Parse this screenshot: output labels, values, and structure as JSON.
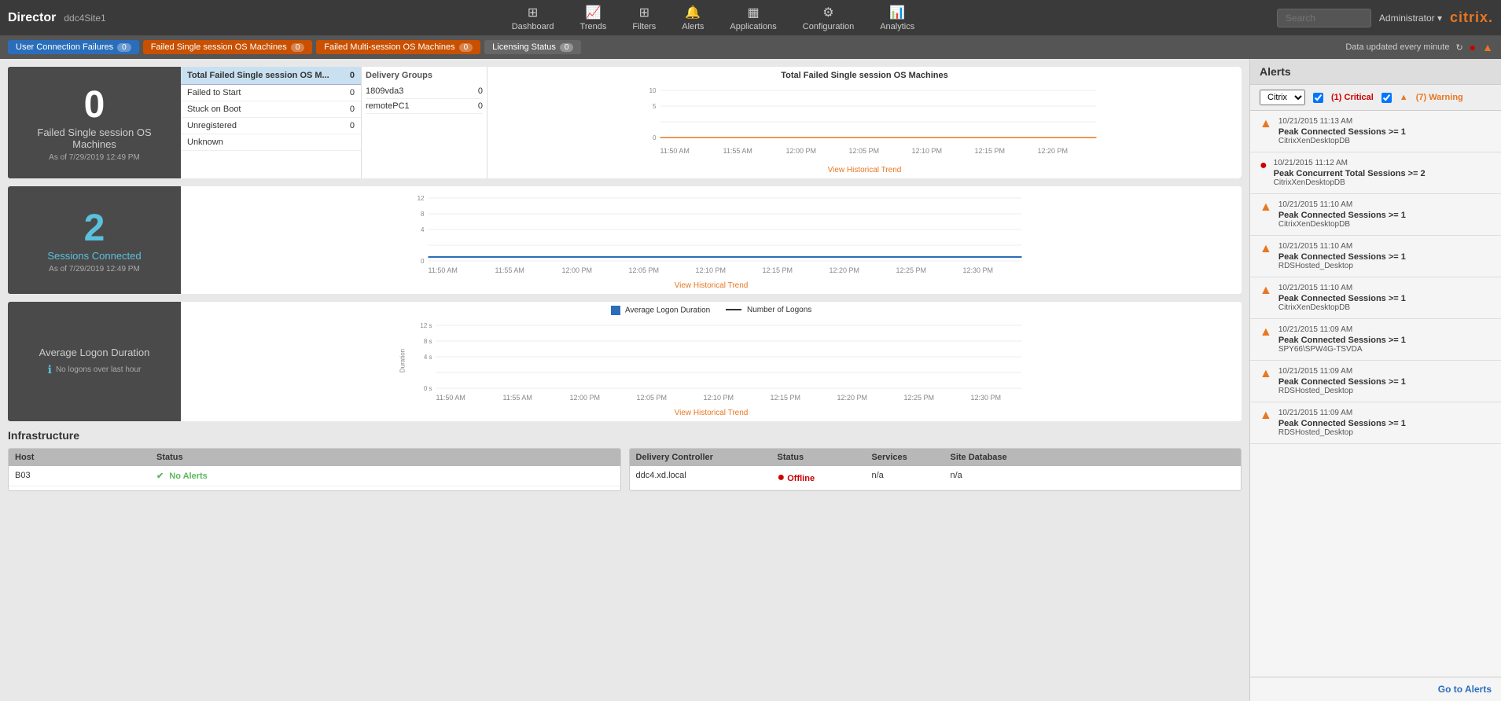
{
  "brand": {
    "title": "Director",
    "subtitle": "ddc4Site1"
  },
  "nav": {
    "items": [
      {
        "label": "Dashboard",
        "icon": "⊞"
      },
      {
        "label": "Trends",
        "icon": "📈"
      },
      {
        "label": "Filters",
        "icon": "🔽"
      },
      {
        "label": "Alerts",
        "icon": "🔔"
      },
      {
        "label": "Applications",
        "icon": "▦"
      },
      {
        "label": "Configuration",
        "icon": "⚙"
      },
      {
        "label": "Analytics",
        "icon": "📊"
      }
    ],
    "search_placeholder": "Search",
    "admin_label": "Administrator ▾",
    "citrix_label": "citrix."
  },
  "status_bar": {
    "badges": [
      {
        "label": "User Connection Failures",
        "count": "0",
        "type": "blue"
      },
      {
        "label": "Failed Single session OS Machines",
        "count": "0",
        "type": "orange"
      },
      {
        "label": "Failed Multi-session OS Machines",
        "count": "0",
        "type": "orange"
      },
      {
        "label": "Licensing Status",
        "count": "0",
        "type": "gray"
      }
    ],
    "update_text": "Data updated every minute",
    "refresh_icon": "↻"
  },
  "failed_machines": {
    "title": "Failed Single session OS Machines",
    "as_of": "As of 7/29/2019 12:49 PM",
    "count": "0",
    "table_header": "Total Failed Single session OS M...",
    "table_header_count": "0",
    "rows": [
      {
        "label": "Failed to Start",
        "count": "0"
      },
      {
        "label": "Stuck on Boot",
        "count": "0"
      },
      {
        "label": "Unregistered",
        "count": "0"
      },
      {
        "label": "Unknown",
        "count": ""
      }
    ],
    "delivery_groups_title": "Delivery Groups",
    "delivery_groups": [
      {
        "label": "1809vda3",
        "count": "0"
      },
      {
        "label": "remotePC1",
        "count": "0"
      }
    ],
    "chart_title": "Total Failed Single session OS Machines",
    "chart_times": [
      "11:50 AM",
      "11:55 AM",
      "12:00 PM",
      "12:05 PM",
      "12:10 PM",
      "12:15 PM",
      "12:20 PM"
    ],
    "view_trend": "View Historical Trend"
  },
  "sessions": {
    "count": "2",
    "label": "Sessions Connected",
    "as_of": "As of 7/29/2019 12:49 PM",
    "chart_times": [
      "11:50 AM",
      "11:55 AM",
      "12:00 PM",
      "12:05 PM",
      "12:10 PM",
      "12:15 PM",
      "12:20 PM",
      "12:25 PM",
      "12:30 PM"
    ],
    "view_trend": "View Historical Trend"
  },
  "logon": {
    "label": "Average Logon Duration",
    "no_logons": "No logons over last hour",
    "legend_avg": "Average Logon Duration",
    "legend_num": "Number of Logons",
    "chart_times": [
      "11:50 AM",
      "11:55 AM",
      "12:00 PM",
      "12:05 PM",
      "12:10 PM",
      "12:15 PM",
      "12:20 PM",
      "12:25 PM",
      "12:30 PM"
    ],
    "y_labels": [
      "12 s",
      "8 s",
      "4 s",
      "0 s"
    ],
    "view_trend": "View Historical Trend"
  },
  "infrastructure": {
    "title": "Infrastructure",
    "host_table": {
      "headers": [
        "Host",
        "Status"
      ],
      "rows": [
        {
          "host": "B03",
          "status": "No Alerts",
          "status_type": "ok"
        }
      ]
    },
    "dc_table": {
      "headers": [
        "Delivery Controller",
        "Status",
        "Services",
        "Site Database"
      ],
      "rows": [
        {
          "dc": "ddc4.xd.local",
          "status": "Offline",
          "status_type": "offline",
          "services": "n/a",
          "sitedb": "n/a"
        }
      ]
    }
  },
  "alerts": {
    "title": "Alerts",
    "filter_label": "Citrix",
    "critical_count": "(1) Critical",
    "warning_count": "(7) Warning",
    "items": [
      {
        "time": "10/21/2015 11:13 AM",
        "type": "warning",
        "message": "Peak Connected Sessions >= 1",
        "source": "CitrixXenDesktopDB"
      },
      {
        "time": "10/21/2015 11:12 AM",
        "type": "critical",
        "message": "Peak Concurrent Total Sessions >= 2",
        "source": "CitrixXenDesktopDB"
      },
      {
        "time": "10/21/2015 11:10 AM",
        "type": "warning",
        "message": "Peak Connected Sessions >= 1",
        "source": "CitrixXenDesktopDB"
      },
      {
        "time": "10/21/2015 11:10 AM",
        "type": "warning",
        "message": "Peak Connected Sessions >= 1",
        "source": "RDSHosted_Desktop"
      },
      {
        "time": "10/21/2015 11:10 AM",
        "type": "warning",
        "message": "Peak Connected Sessions >= 1",
        "source": "CitrixXenDesktopDB"
      },
      {
        "time": "10/21/2015 11:09 AM",
        "type": "warning",
        "message": "Peak Connected Sessions >= 1",
        "source": "SPY66\\SPW4G-TSVDA"
      },
      {
        "time": "10/21/2015 11:09 AM",
        "type": "warning",
        "message": "Peak Connected Sessions >= 1",
        "source": "RDSHosted_Desktop"
      },
      {
        "time": "10/21/2015 11:09 AM",
        "type": "warning",
        "message": "Peak Connected Sessions >= 1",
        "source": "RDSHosted_Desktop"
      }
    ],
    "go_to_alerts": "Go to Alerts"
  }
}
